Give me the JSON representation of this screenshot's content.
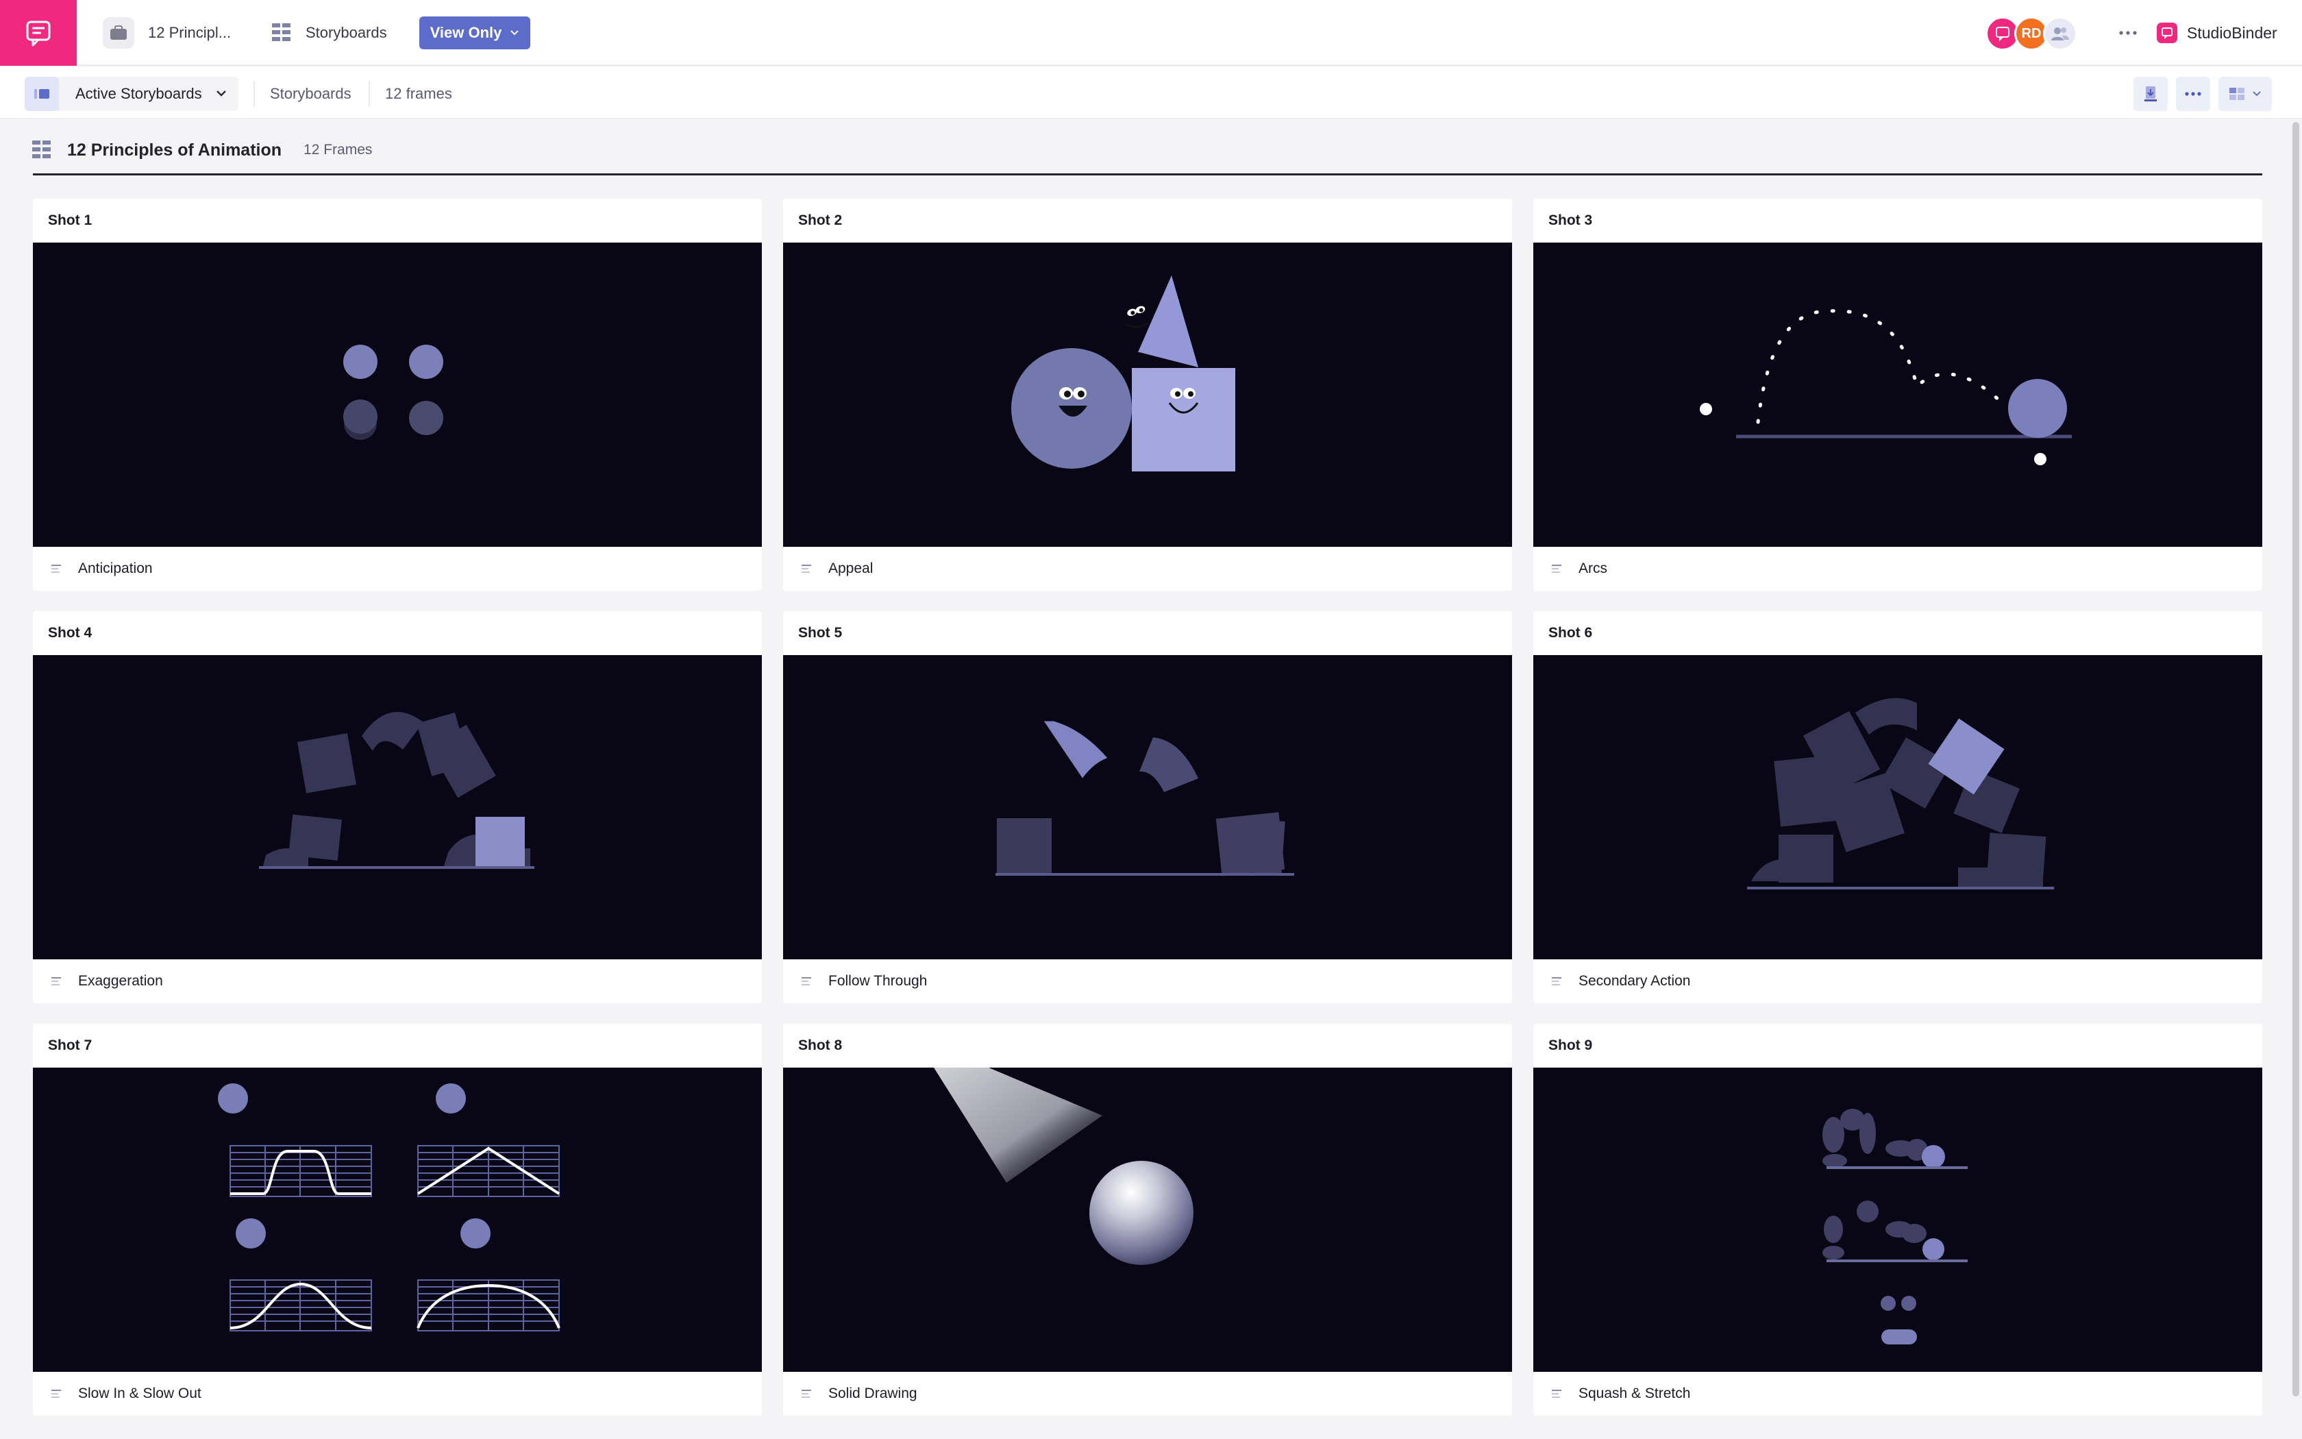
{
  "header": {
    "project_title": "12 Principl...",
    "storyboards_label": "Storyboards",
    "view_only_label": "View Only",
    "avatar_initials": "RD",
    "brand_name": "StudioBinder"
  },
  "subheader": {
    "dropdown_label": "Active Storyboards",
    "storyboards_link": "Storyboards",
    "frames_link": "12 frames"
  },
  "page": {
    "title": "12 Principles of Animation",
    "frames_count": "12 Frames"
  },
  "colors": {
    "brand_pink": "#f0287f",
    "accent_indigo": "#5d6bc9",
    "frame_background": "#090716",
    "shape_lavender": "#8c90c8"
  },
  "shots": [
    {
      "shot_label": "Shot 1",
      "name": "Anticipation",
      "icon": "note-icon"
    },
    {
      "shot_label": "Shot 2",
      "name": "Appeal",
      "icon": "note-icon"
    },
    {
      "shot_label": "Shot 3",
      "name": "Arcs",
      "icon": "note-icon"
    },
    {
      "shot_label": "Shot 4",
      "name": "Exaggeration",
      "icon": "note-icon"
    },
    {
      "shot_label": "Shot 5",
      "name": "Follow Through",
      "icon": "note-icon"
    },
    {
      "shot_label": "Shot 6",
      "name": "Secondary Action",
      "icon": "note-icon"
    },
    {
      "shot_label": "Shot 7",
      "name": "Slow In & Slow Out",
      "icon": "note-icon"
    },
    {
      "shot_label": "Shot 8",
      "name": "Solid Drawing",
      "icon": "note-icon"
    },
    {
      "shot_label": "Shot 9",
      "name": "Squash & Stretch",
      "icon": "note-icon"
    }
  ]
}
